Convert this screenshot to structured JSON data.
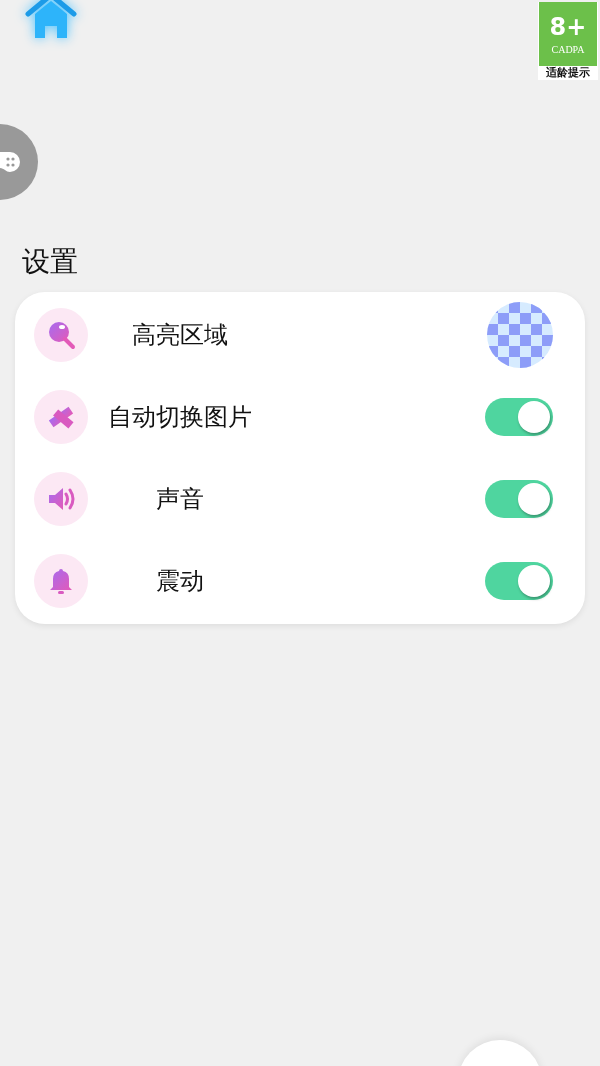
{
  "age_badge": {
    "rating": "8+",
    "org": "CADPA",
    "caption": "适龄提示"
  },
  "title": "设置",
  "items": [
    {
      "label": "高亮区域",
      "kind": "checker"
    },
    {
      "label": "自动切换图片",
      "kind": "toggle",
      "on": true
    },
    {
      "label": "声音",
      "kind": "toggle",
      "on": true
    },
    {
      "label": "震动",
      "kind": "toggle",
      "on": true
    }
  ]
}
